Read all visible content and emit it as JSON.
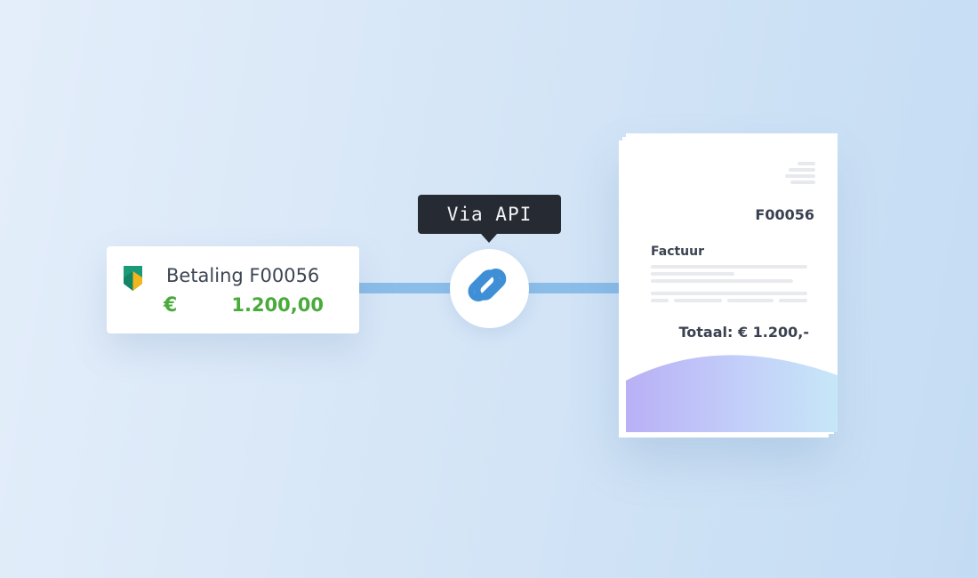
{
  "payment": {
    "title": "Betaling F00056",
    "currency_symbol": "€",
    "amount": "1.200,00",
    "bank_logo_icon": "bank-shield-icon",
    "amount_color": "#4aaa3b"
  },
  "connector": {
    "tooltip_label": "Via API",
    "link_icon": "chain-link-icon",
    "line_color": "#8bbde9",
    "icon_color": "#3f8fd6"
  },
  "invoice": {
    "number": "F00056",
    "label": "Factuur",
    "total": "Totaal: € 1.200,-"
  }
}
